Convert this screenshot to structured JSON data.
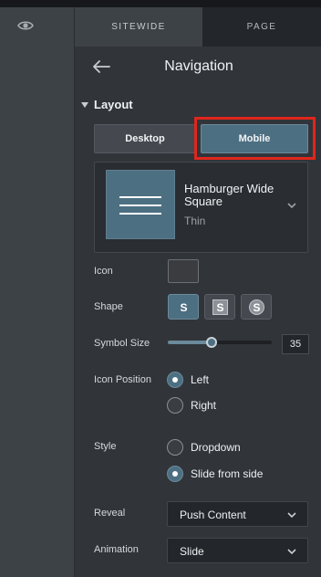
{
  "tabs": [
    {
      "label": "SITEWIDE",
      "active": true
    },
    {
      "label": "PAGE",
      "active": false
    }
  ],
  "header": {
    "title": "Navigation"
  },
  "section": {
    "title": "Layout"
  },
  "device": {
    "options": [
      "Desktop",
      "Mobile"
    ],
    "selected": "Mobile"
  },
  "menu_style": {
    "name": "Hamburger Wide Square",
    "weight": "Thin"
  },
  "icon": {
    "label": "Icon"
  },
  "shape": {
    "label": "Shape",
    "options": [
      {
        "glyph": "S",
        "style": "plain",
        "selected": true
      },
      {
        "glyph": "S",
        "style": "square",
        "selected": false
      },
      {
        "glyph": "S",
        "style": "circle",
        "selected": false
      }
    ]
  },
  "symbol_size": {
    "label": "Symbol Size",
    "value": "35",
    "fraction": 0.42
  },
  "icon_position": {
    "label": "Icon Position",
    "options": [
      {
        "label": "Left",
        "checked": true
      },
      {
        "label": "Right",
        "checked": false
      }
    ]
  },
  "style": {
    "label": "Style",
    "options": [
      {
        "label": "Dropdown",
        "checked": false
      },
      {
        "label": "Slide from side",
        "checked": true
      }
    ]
  },
  "reveal": {
    "label": "Reveal",
    "value": "Push Content"
  },
  "animation": {
    "label": "Animation",
    "value": "Slide"
  },
  "colors": {
    "accent": "#4d6f82",
    "highlight": "#e0261c",
    "panel": "#31353a"
  }
}
